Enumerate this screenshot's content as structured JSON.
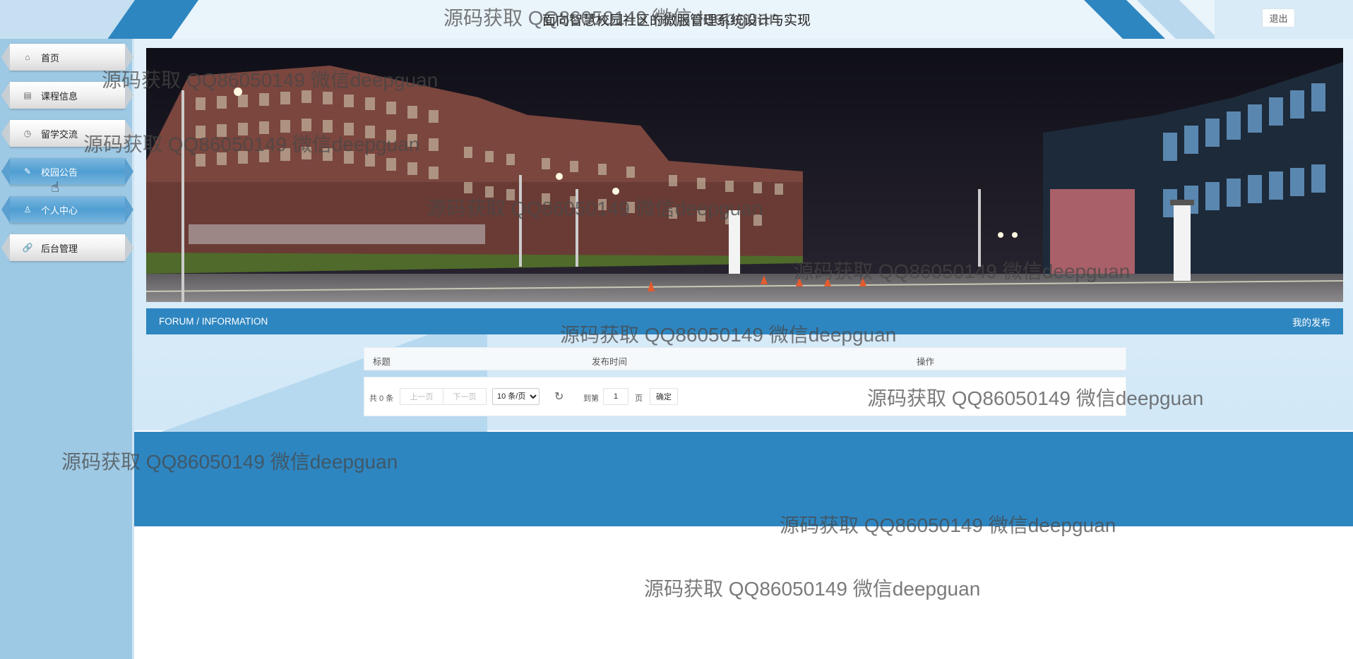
{
  "header": {
    "title": "面向智慧校园社区的微服管理系统设计与实现",
    "logout_label": "退出"
  },
  "sidebar": {
    "items": [
      {
        "label": "首页",
        "icon": "home-icon"
      },
      {
        "label": "课程信息",
        "icon": "document-icon"
      },
      {
        "label": "留学交流",
        "icon": "clock-icon"
      },
      {
        "label": "校园公告",
        "icon": "edit-icon"
      },
      {
        "label": "个人中心",
        "icon": "user-icon"
      },
      {
        "label": "后台管理",
        "icon": "link-icon"
      }
    ]
  },
  "banner": {
    "slide_count": 3,
    "active_slide": 1
  },
  "section": {
    "title": "FORUM / INFORMATION",
    "my_posts_label": "我的发布"
  },
  "table": {
    "columns": [
      "标题",
      "发布时间",
      "操作"
    ]
  },
  "pager": {
    "total_text": "共 0 条",
    "prev_label": "上一页",
    "next_label": "下一页",
    "page_size_selected": "10 条/页",
    "goto_label": "到第",
    "page_value": "1",
    "page_unit": "页",
    "confirm_label": "确定"
  },
  "watermark": "源码获取 QQ86050149 微信deepguan",
  "colors": {
    "primary": "#2e86c1",
    "sidebar": "#9ec9e4",
    "menu_active": "#4f9ed3"
  }
}
